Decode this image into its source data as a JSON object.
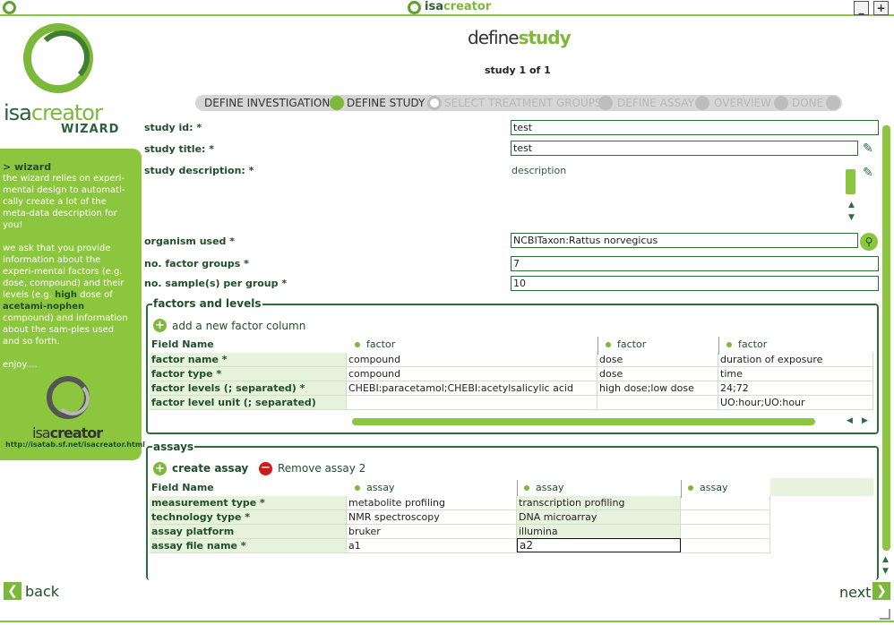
{
  "app": {
    "title_prefix": "isa",
    "title_suffix": "creator",
    "min_label": "_",
    "max_label": "+"
  },
  "logo": {
    "isa": "isa",
    "creator": "creator",
    "wizard": "WIZARD"
  },
  "sidebar": {
    "heading": "> wizard",
    "para1": "the wizard relies on experi-mental design to automati-cally create a lot of the meta-data description for you!",
    "para2_a": "we ask that you provide information about the experi-mental factors (e.g. dose, compound) and their levels (e.g. ",
    "para2_high": "high",
    "para2_b": " dose of ",
    "para2_drug": "acetami-nophen",
    "para2_c": " compound) and information about the sam-ples used and so forth.",
    "para3": "enjoy....",
    "mini_isa": "isa",
    "mini_creator": "creator",
    "url": "http://isatab.sf.net/isacreator.html"
  },
  "header": {
    "title_define": "define",
    "title_study": "study",
    "counter": "study 1 of 1"
  },
  "steps": [
    {
      "label": "DEFINE INVESTIGATION",
      "state": "done"
    },
    {
      "label": "DEFINE STUDY",
      "state": "done"
    },
    {
      "label": "SELECT TREATMENT GROUPS",
      "state": "todo"
    },
    {
      "label": "DEFINE ASSAY",
      "state": "todo"
    },
    {
      "label": "OVERVIEW",
      "state": "todo"
    },
    {
      "label": "DONE",
      "state": "todo"
    }
  ],
  "form": {
    "study_id_label": "study id: *",
    "study_id_value": "test",
    "study_title_label": "study title: *",
    "study_title_value": "test",
    "study_desc_label": "study description: *",
    "study_desc_value": "description",
    "organism_label": "organism used *",
    "organism_value": "NCBITaxon:Rattus norvegicus",
    "factor_groups_label": "no. factor groups *",
    "factor_groups_value": "7",
    "samples_label": "no. sample(s) per group *",
    "samples_value": "10"
  },
  "factors": {
    "section_title": "factors and levels",
    "add_label": "add a new factor column",
    "field_name_header": "Field Name",
    "columns": [
      "factor",
      "factor",
      "factor"
    ],
    "rows": [
      {
        "label": "factor name *",
        "values": [
          "compound",
          "dose",
          "duration of exposure"
        ]
      },
      {
        "label": "factor type *",
        "values": [
          "compound",
          "dose",
          "time"
        ]
      },
      {
        "label": "factor levels (; separated) *",
        "values": [
          "CHEBI:paracetamol;CHEBI:acetylsalicylic acid",
          "high dose;low dose",
          "24;72"
        ]
      },
      {
        "label": "factor level unit (; separated)",
        "values": [
          "",
          "",
          "UO:hour;UO:hour"
        ]
      }
    ]
  },
  "assays": {
    "section_title": "assays",
    "create_label": "create assay",
    "remove_label": "Remove assay 2",
    "field_name_header": "Field Name",
    "columns": [
      "assay",
      "assay",
      "assay"
    ],
    "rows": [
      {
        "label": "measurement type *",
        "values": [
          "metabolite profiling",
          "transcription profiling",
          ""
        ]
      },
      {
        "label": "technology type *",
        "values": [
          "NMR spectroscopy",
          "DNA microarray",
          ""
        ]
      },
      {
        "label": "assay platform",
        "values": [
          "bruker",
          "illumina",
          ""
        ]
      },
      {
        "label": "assay file name *",
        "values": [
          "a1",
          "a2",
          ""
        ]
      }
    ]
  },
  "nav": {
    "back": "back",
    "next": "next"
  }
}
